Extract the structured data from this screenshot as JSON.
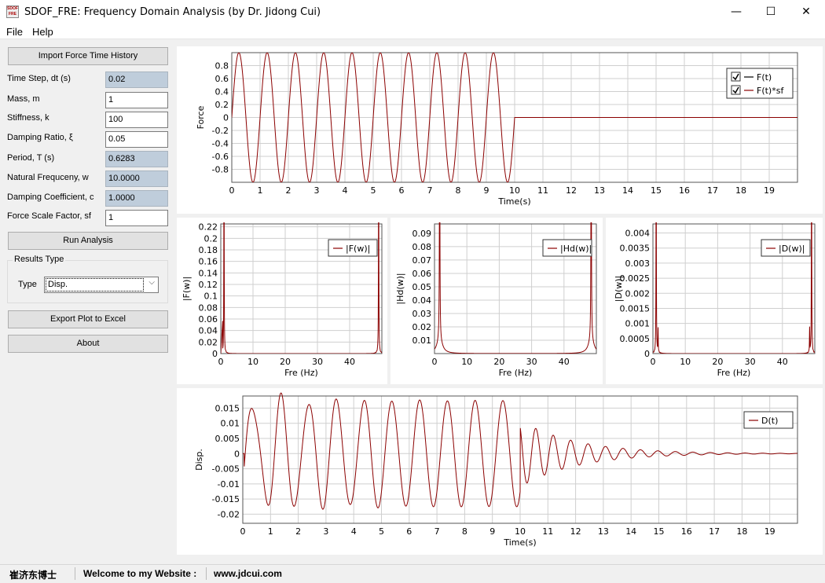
{
  "window": {
    "title": "SDOF_FRE: Frequency Domain Analysis (by Dr. Jidong Cui)",
    "icon_text": "SDOF FRE",
    "minimize_glyph": "—",
    "maximize_glyph": "☐",
    "close_glyph": "✕"
  },
  "menu": {
    "file": "File",
    "help": "Help"
  },
  "panel": {
    "import_button": "Import Force Time History",
    "params": [
      {
        "label": "Time Step, dt (s)",
        "value": "0.02",
        "readonly": true
      },
      {
        "label": "Mass, m",
        "value": "1",
        "readonly": false
      },
      {
        "label": "Stiffness, k",
        "value": "100",
        "readonly": false
      },
      {
        "label": "Damping Ratio, ξ",
        "value": "0.05",
        "readonly": false
      },
      {
        "label": "Period, T (s)",
        "value": "0.6283",
        "readonly": true
      },
      {
        "label": "Natural Frequceny, w",
        "value": "10.0000",
        "readonly": true
      },
      {
        "label": "Damping Coefficient, c",
        "value": "1.0000",
        "readonly": true
      },
      {
        "label": "Force Scale Factor, sf",
        "value": "1",
        "readonly": false
      }
    ],
    "run_button": "Run Analysis",
    "results_group": "Results Type",
    "type_label": "Type",
    "type_value": "Disp.",
    "export_button": "Export Plot to Excel",
    "about_button": "About"
  },
  "status": {
    "name": "崔济东博士",
    "welcome": "Welcome to my Website :",
    "url": "www.jdcui.com"
  },
  "colors": {
    "series": "#8b0000",
    "grid": "#cfcfcf",
    "readonly_field": "#bfcddb"
  },
  "chart_data": [
    {
      "type": "line",
      "xlabel": "Time(s)",
      "ylabel": "Force",
      "xlim": [
        0,
        20
      ],
      "ylim": [
        -1,
        1
      ],
      "xticks": [
        0,
        1,
        2,
        3,
        4,
        5,
        6,
        7,
        8,
        9,
        10,
        11,
        12,
        13,
        14,
        15,
        16,
        17,
        18,
        19
      ],
      "yticks": [
        -0.8,
        -0.6,
        -0.4,
        -0.2,
        0,
        0.2,
        0.4,
        0.6,
        0.8
      ],
      "ytick_labels": [
        "-0.8",
        "-0.6",
        "-0.4",
        "-0.2",
        "0",
        "0.2",
        "0.4",
        "0.6",
        "0.8"
      ],
      "legend": [
        "F(t)",
        "F(t)*sf"
      ],
      "legend_checked": [
        true,
        true
      ],
      "legend_position": "top-right",
      "grid": true,
      "series": [
        {
          "name": "F(t)*sf",
          "description": "sin(2*pi*t) for 0<=t<=10, then 0",
          "amplitude": 1,
          "frequency_hz": 1,
          "end_time": 10
        }
      ]
    },
    {
      "type": "line",
      "xlabel": "Fre (Hz)",
      "ylabel": "|F(w)|",
      "xlim": [
        0,
        50
      ],
      "ylim": [
        0,
        0.225
      ],
      "xticks": [
        0,
        10,
        20,
        30,
        40
      ],
      "yticks": [
        0,
        0.02,
        0.04,
        0.06,
        0.08,
        0.1,
        0.12,
        0.14,
        0.16,
        0.18,
        0.2,
        0.22
      ],
      "ytick_labels": [
        "0",
        "0.02",
        "0.04",
        "0.06",
        "0.08",
        "0.1",
        "0.12",
        "0.14",
        "0.16",
        "0.18",
        "0.2",
        "0.22"
      ],
      "legend": [
        "|F(w)|"
      ],
      "legend_position": "top-right",
      "grid": true,
      "peaks_hz": [
        1,
        49
      ]
    },
    {
      "type": "line",
      "xlabel": "Fre (Hz)",
      "ylabel": "|Hd(w)|",
      "xlim": [
        0,
        50
      ],
      "ylim": [
        0,
        0.097
      ],
      "xticks": [
        0,
        10,
        20,
        30,
        40
      ],
      "yticks": [
        0.01,
        0.02,
        0.03,
        0.04,
        0.05,
        0.06,
        0.07,
        0.08,
        0.09
      ],
      "ytick_labels": [
        "0.01",
        "0.02",
        "0.03",
        "0.04",
        "0.05",
        "0.06",
        "0.07",
        "0.08",
        "0.09"
      ],
      "legend": [
        "|Hd(w)|"
      ],
      "legend_position": "top-right",
      "grid": true,
      "peaks_hz": [
        1.59,
        48.4
      ]
    },
    {
      "type": "line",
      "xlabel": "Fre (Hz)",
      "ylabel": "|D(w)|",
      "xlim": [
        0,
        50
      ],
      "ylim": [
        0,
        0.0043
      ],
      "xticks": [
        0,
        10,
        20,
        30,
        40
      ],
      "yticks": [
        0,
        0.0005,
        0.001,
        0.0015,
        0.002,
        0.0025,
        0.003,
        0.0035,
        0.004
      ],
      "ytick_labels": [
        "0",
        "0.0005",
        "0.001",
        "0.0015",
        "0.002",
        "0.0025",
        "0.003",
        "0.0035",
        "0.004"
      ],
      "legend": [
        "|D(w)|"
      ],
      "legend_position": "top-right",
      "grid": true,
      "peaks_hz": [
        1,
        49
      ]
    },
    {
      "type": "line",
      "xlabel": "Time(s)",
      "ylabel": "Disp.",
      "xlim": [
        0,
        20
      ],
      "ylim": [
        -0.023,
        0.019
      ],
      "xticks": [
        0,
        1,
        2,
        3,
        4,
        5,
        6,
        7,
        8,
        9,
        10,
        11,
        12,
        13,
        14,
        15,
        16,
        17,
        18,
        19
      ],
      "yticks": [
        -0.02,
        -0.015,
        -0.01,
        -0.005,
        0,
        0.005,
        0.01,
        0.015
      ],
      "ytick_labels": [
        "-0.02",
        "-0.015",
        "-0.01",
        "-0.005",
        "0",
        "0.005",
        "0.01",
        "0.015"
      ],
      "legend": [
        "D(t)"
      ],
      "legend_position": "top-right",
      "grid": true,
      "series": [
        {
          "name": "D(t)",
          "description": "steady-state response ~0.0175 amplitude at 1 Hz until t=10 s, then free vibration at 1.59 Hz decaying"
        }
      ]
    }
  ]
}
